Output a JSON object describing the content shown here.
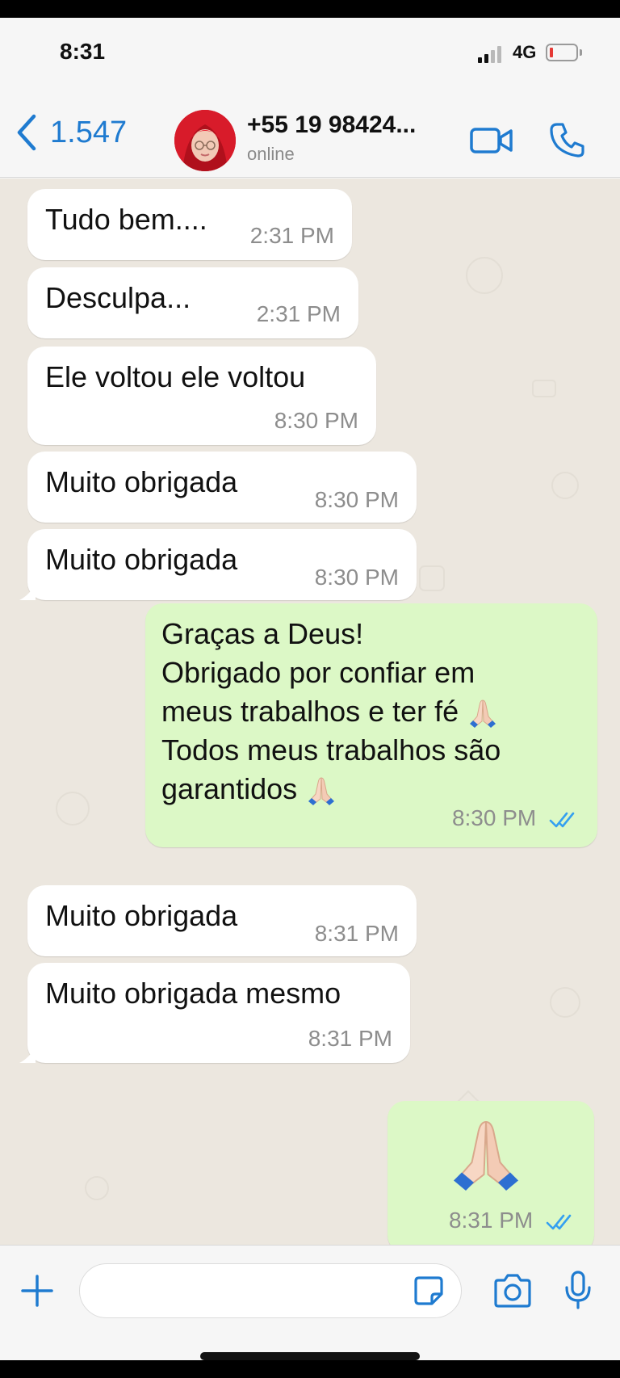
{
  "status_bar": {
    "time": "8:31",
    "network": "4G"
  },
  "header": {
    "back_count": "1.547",
    "contact_name": "+55 19 98424...",
    "contact_status": "online"
  },
  "colors": {
    "accent": "#1f7bd0",
    "incoming_bubble": "#ffffff",
    "outgoing_bubble": "#dcf8c6",
    "chat_bg": "#ece7df"
  },
  "messages": [
    {
      "direction": "in",
      "text": "Tudo bem....",
      "time": "2:31 PM"
    },
    {
      "direction": "in",
      "text": "Desculpa...",
      "time": "2:31 PM"
    },
    {
      "direction": "in",
      "text": "Ele voltou ele voltou",
      "time": "8:30 PM"
    },
    {
      "direction": "in",
      "text": "Muito obrigada",
      "time": "8:30 PM"
    },
    {
      "direction": "in",
      "text": "Muito obrigada",
      "time": "8:30 PM"
    },
    {
      "direction": "out",
      "lines": [
        "Graças a Deus!",
        "Obrigado por confiar em",
        "meus trabalhos e ter fé",
        "Todos meus trabalhos são",
        "garantidos"
      ],
      "emoji": "folded-hands",
      "time": "8:30 PM",
      "status": "read"
    },
    {
      "direction": "in",
      "text": "Muito obrigada",
      "time": "8:31 PM"
    },
    {
      "direction": "in",
      "text": "Muito obrigada mesmo",
      "time": "8:31 PM"
    },
    {
      "direction": "out",
      "emoji": "folded-hands",
      "time": "8:31 PM",
      "status": "read"
    }
  ],
  "composer": {
    "placeholder": ""
  }
}
